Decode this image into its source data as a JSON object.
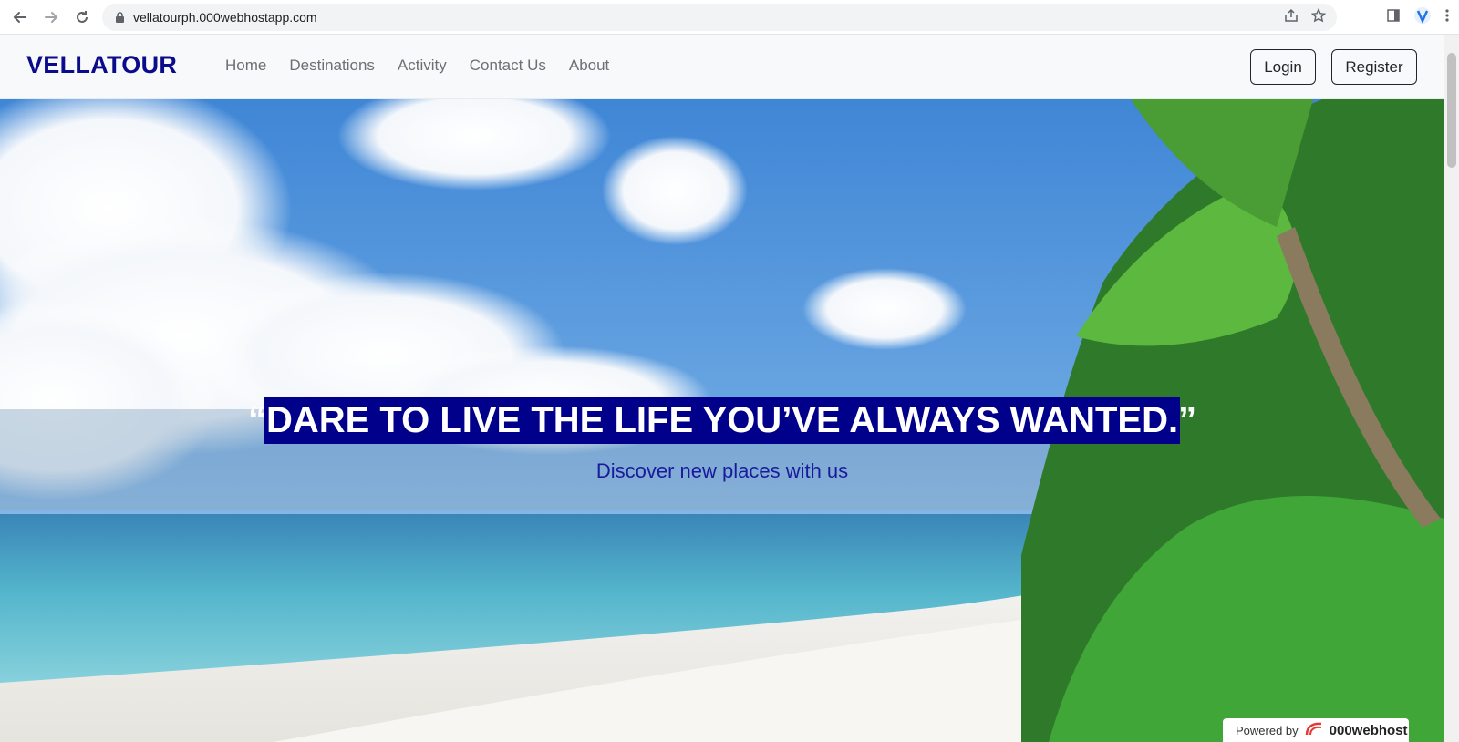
{
  "browser": {
    "url": "vellatourph.000webhostapp.com"
  },
  "site": {
    "brand": "VELLATOUR",
    "nav": [
      {
        "label": "Home"
      },
      {
        "label": "Destinations"
      },
      {
        "label": "Activity"
      },
      {
        "label": "Contact Us"
      },
      {
        "label": "About"
      }
    ],
    "login_label": "Login",
    "register_label": "Register"
  },
  "hero": {
    "headline": "“DARE TO LIVE THE LIFE YOU’VE ALWAYS WANTED.”",
    "subheadline": "Discover new places with us"
  },
  "footer_badge": {
    "powered_by": "Powered by",
    "host": "000webhost"
  },
  "colors": {
    "brand": "#0a0c8c",
    "headline_bg": "#00008b"
  }
}
